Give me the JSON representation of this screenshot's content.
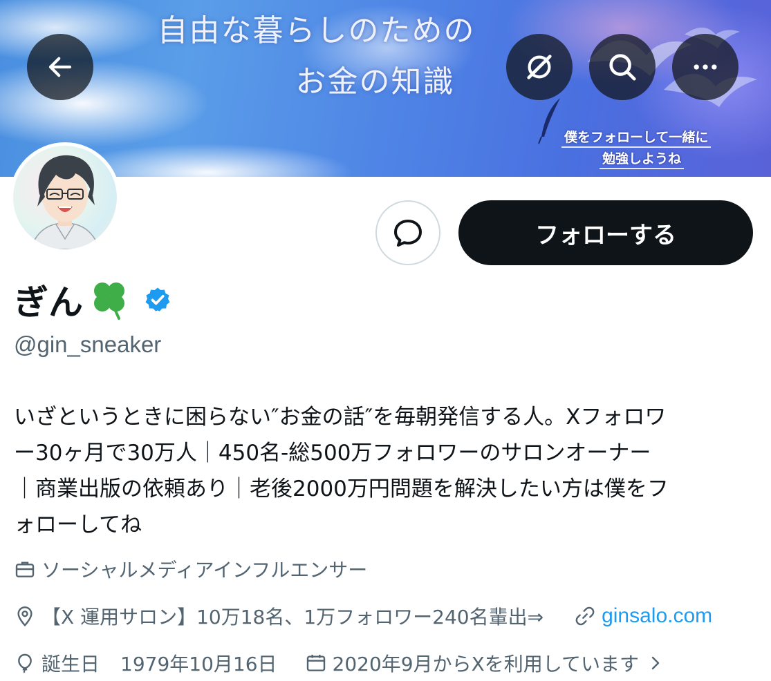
{
  "banner": {
    "title_line1": "自由な暮らしのための",
    "title_line2": "お金の知識",
    "tag_line1": "僕をフォローして一緒に",
    "tag_line2": "勉強しようね"
  },
  "header_buttons": {
    "back_icon": "arrow-left-icon",
    "grok_icon": "grok-slash-icon",
    "search_icon": "search-icon",
    "more_icon": "more-horizontal-icon"
  },
  "profile": {
    "display_name": "ぎん",
    "name_emoji": "four-leaf-clover",
    "verified_color": "#1d9bf0",
    "handle": "@gin_sneaker",
    "bio_lines": [
      "いざというときに困らない″お金の話″を毎朝発信する人。Xフォロワ",
      "ー30ヶ月で30万人｜450名-総500万フォロワーのサロンオーナー",
      "｜商業出版の依頼あり｜老後2000万円問題を解決したい方は僕をフ",
      "ォローしてね"
    ],
    "category": "ソーシャルメディアインフルエンサー",
    "location": "【X 運用サロン】10万18名、1万フォロワー240名輩出⇒",
    "website": "ginsalo.com",
    "birthday_label": "誕生日",
    "birthday_value": "1979年10月16日",
    "joined": "2020年9月からXを利用しています"
  },
  "actions": {
    "follow_label": "フォローする",
    "message_icon": "message-bubble-icon"
  },
  "colors": {
    "text_primary": "#0f1419",
    "text_secondary": "#536471",
    "link": "#1d9bf0",
    "button_dark": "#0f1419"
  }
}
